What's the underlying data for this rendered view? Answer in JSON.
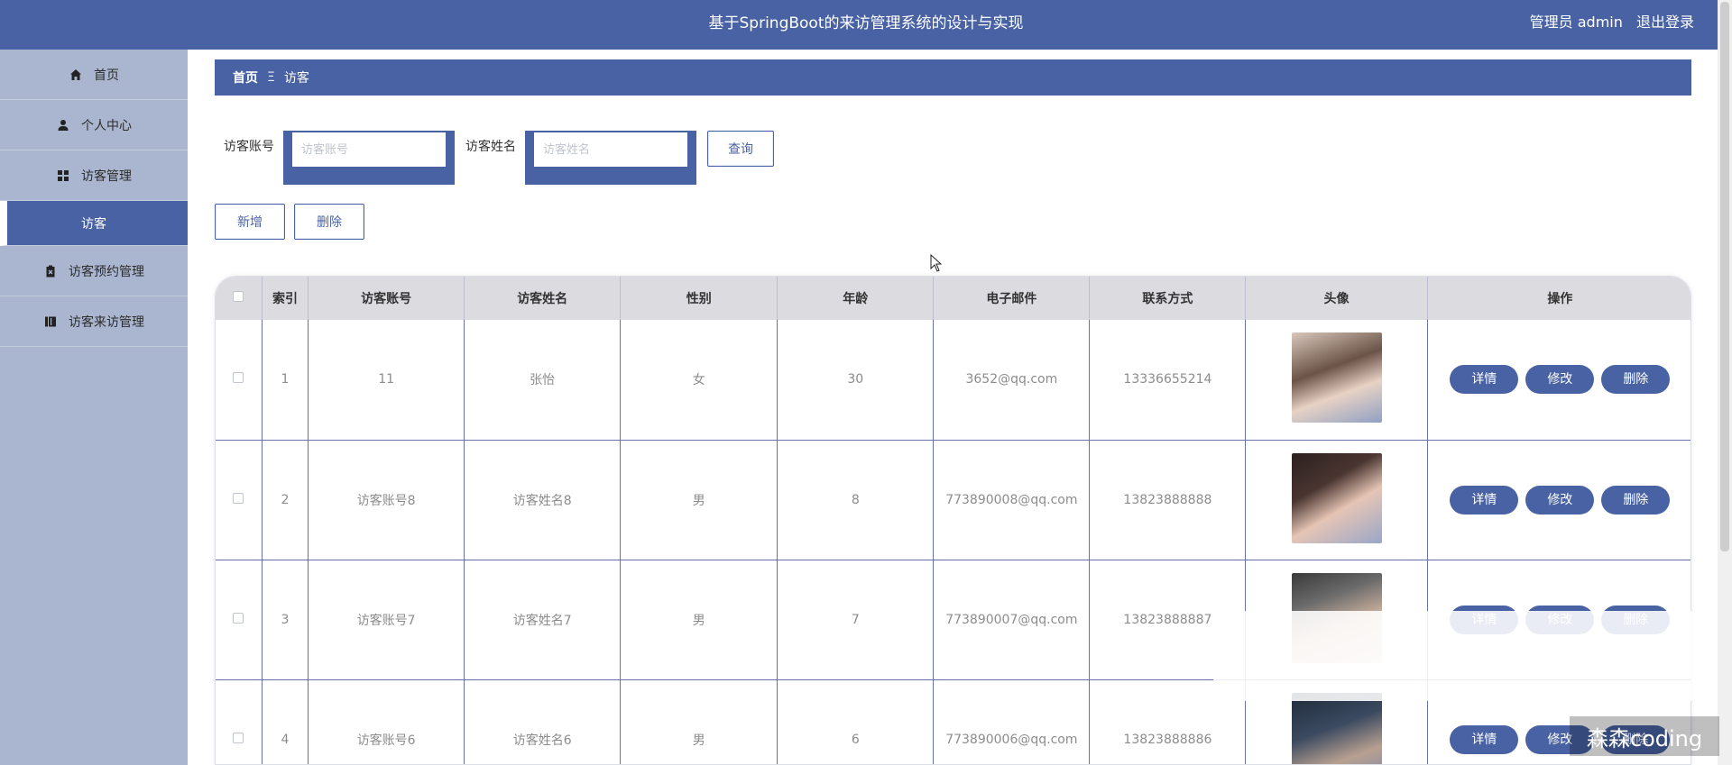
{
  "header": {
    "title": "基于SpringBoot的来访管理系统的设计与实现",
    "user_label": "管理员 admin",
    "logout_label": "退出登录"
  },
  "sidebar": {
    "items": [
      {
        "label": "首页",
        "icon": "home-icon"
      },
      {
        "label": "个人中心",
        "icon": "user-icon"
      },
      {
        "label": "访客管理",
        "icon": "grid-icon"
      },
      {
        "label": "访客",
        "icon": ""
      },
      {
        "label": "访客预约管理",
        "icon": "clipboard-icon"
      },
      {
        "label": "访客来访管理",
        "icon": "book-icon"
      }
    ]
  },
  "breadcrumb": {
    "home": "首页",
    "separator": "Ξ",
    "current": "访客"
  },
  "search": {
    "account_label": "访客账号",
    "account_placeholder": "访客账号",
    "name_label": "访客姓名",
    "name_placeholder": "访客姓名",
    "query_button": "查询"
  },
  "actions": {
    "add_button": "新增",
    "delete_button": "删除"
  },
  "table": {
    "headers": [
      "",
      "索引",
      "访客账号",
      "访客姓名",
      "性别",
      "年龄",
      "电子邮件",
      "联系方式",
      "头像",
      "操作"
    ],
    "rows": [
      {
        "index": "1",
        "account": "11",
        "name": "张怡",
        "gender": "女",
        "age": "30",
        "email": "3652@qq.com",
        "phone": "13336655214"
      },
      {
        "index": "2",
        "account": "访客账号8",
        "name": "访客姓名8",
        "gender": "男",
        "age": "8",
        "email": "773890008@qq.com",
        "phone": "13823888888"
      },
      {
        "index": "3",
        "account": "访客账号7",
        "name": "访客姓名7",
        "gender": "男",
        "age": "7",
        "email": "773890007@qq.com",
        "phone": "13823888887"
      },
      {
        "index": "4",
        "account": "访客账号6",
        "name": "访客姓名6",
        "gender": "男",
        "age": "6",
        "email": "773890006@qq.com",
        "phone": "13823888886"
      }
    ],
    "row_actions": {
      "detail": "详情",
      "edit": "修改",
      "delete": "删除"
    }
  },
  "watermark": "森森coding",
  "colors": {
    "primary": "#4862a4",
    "sidebar_bg": "#aab5cf",
    "table_header_bg": "#dbdbe0"
  }
}
